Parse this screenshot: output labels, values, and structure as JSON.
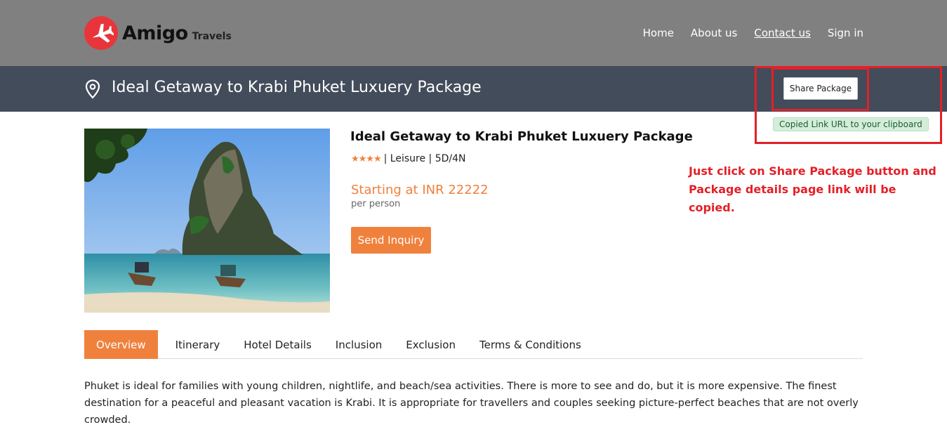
{
  "header": {
    "brand": "Amigo",
    "brand_sub": "Travels",
    "nav": [
      {
        "label": "Home"
      },
      {
        "label": "About us"
      },
      {
        "label": "Contact us"
      },
      {
        "label": "Sign in"
      }
    ]
  },
  "titlebar": {
    "title": "Ideal Getaway to Krabi Phuket Luxuery Package",
    "share_label": "Share Package",
    "copied_label": "Copied Link URL to your clipboard"
  },
  "annotation": {
    "line1": "Just click on Share Package button and",
    "line2": "Package details page link will be copied."
  },
  "package": {
    "name": "Ideal Getaway to Krabi Phuket Luxuery Package",
    "stars": "★★★★",
    "rating": 4,
    "meta": "| Leisure | 5D/4N",
    "price": "Starting at INR 22222",
    "per": "per person",
    "inquiry_label": "Send Inquiry"
  },
  "tabs": [
    {
      "label": "Overview",
      "active": true
    },
    {
      "label": "Itinerary"
    },
    {
      "label": "Hotel Details"
    },
    {
      "label": "Inclusion"
    },
    {
      "label": "Exclusion"
    },
    {
      "label": "Terms & Conditions"
    }
  ],
  "overview": {
    "text": "Phuket is ideal for families with young children, nightlife, and beach/sea activities. There is more to see and do, but it is more expensive. The finest destination for a peaceful and pleasant vacation is Krabi. It is appropriate for travellers and couples seeking picture-perfect beaches that are not overly crowded."
  },
  "colors": {
    "accent": "#f0813c",
    "header_bg": "#808080",
    "titlebar_bg": "#434c5a",
    "annotation_red": "#e32028",
    "success_bg": "#d4edda"
  }
}
